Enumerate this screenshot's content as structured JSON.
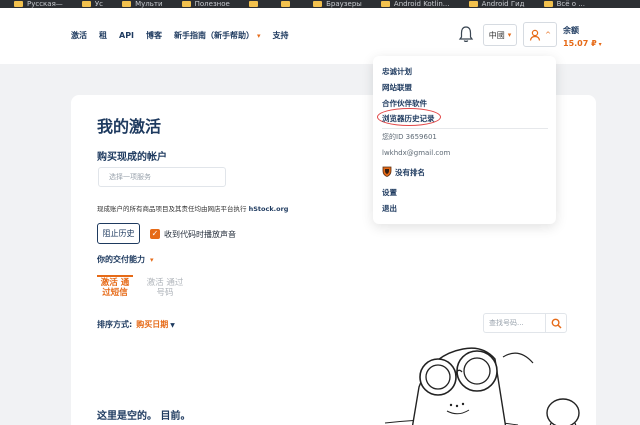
{
  "bookmarks": [
    "Русская—",
    "Ус",
    "Мульти",
    "Полезное",
    "",
    "",
    "Браузеры",
    "Android Kotlin...",
    "Android Гид",
    "Всё о ..."
  ],
  "header": {
    "nav": [
      {
        "label": "激活",
        "has_caret": false
      },
      {
        "label": "租",
        "has_caret": false
      },
      {
        "label": "API",
        "has_caret": false
      },
      {
        "label": "博客",
        "has_caret": false
      },
      {
        "label": "新手指南（新手帮助）",
        "has_caret": true
      },
      {
        "label": "支持",
        "has_caret": false
      }
    ],
    "language": "中國",
    "balance_label": "余额",
    "balance_value": "15.07 ₽"
  },
  "dropdown": {
    "items": [
      "忠诚计划",
      "网站联盟",
      "合作伙伴软件",
      "浏览器历史记录"
    ],
    "user_id": "您的ID 3659601",
    "email": "lwkhdx@gmail.com",
    "rank": "没有排名",
    "settings": "设置",
    "logout": "退出"
  },
  "main": {
    "title": "我的激活",
    "section_title": "购买现成的帐户",
    "service_placeholder": "选择一项服务",
    "disclaimer_text": "现成账户的所有商品项目及其责任均由网店平台执行",
    "disclaimer_link": "hStock.org",
    "block_history": "阻止历史",
    "sound_label": "收到代码时播放声音",
    "power_label": "你的交付能力",
    "tab_sms": "激活 通过短信",
    "tab_number": "激活 通过号码",
    "sort_label": "排序方式:",
    "sort_value": "购买日期",
    "search_placeholder": "查找号码...",
    "empty_text": "这里是空的。 目前。"
  },
  "colors": {
    "accent": "#e66a17",
    "primary": "#1e3a5f",
    "highlight": "#e24848"
  }
}
